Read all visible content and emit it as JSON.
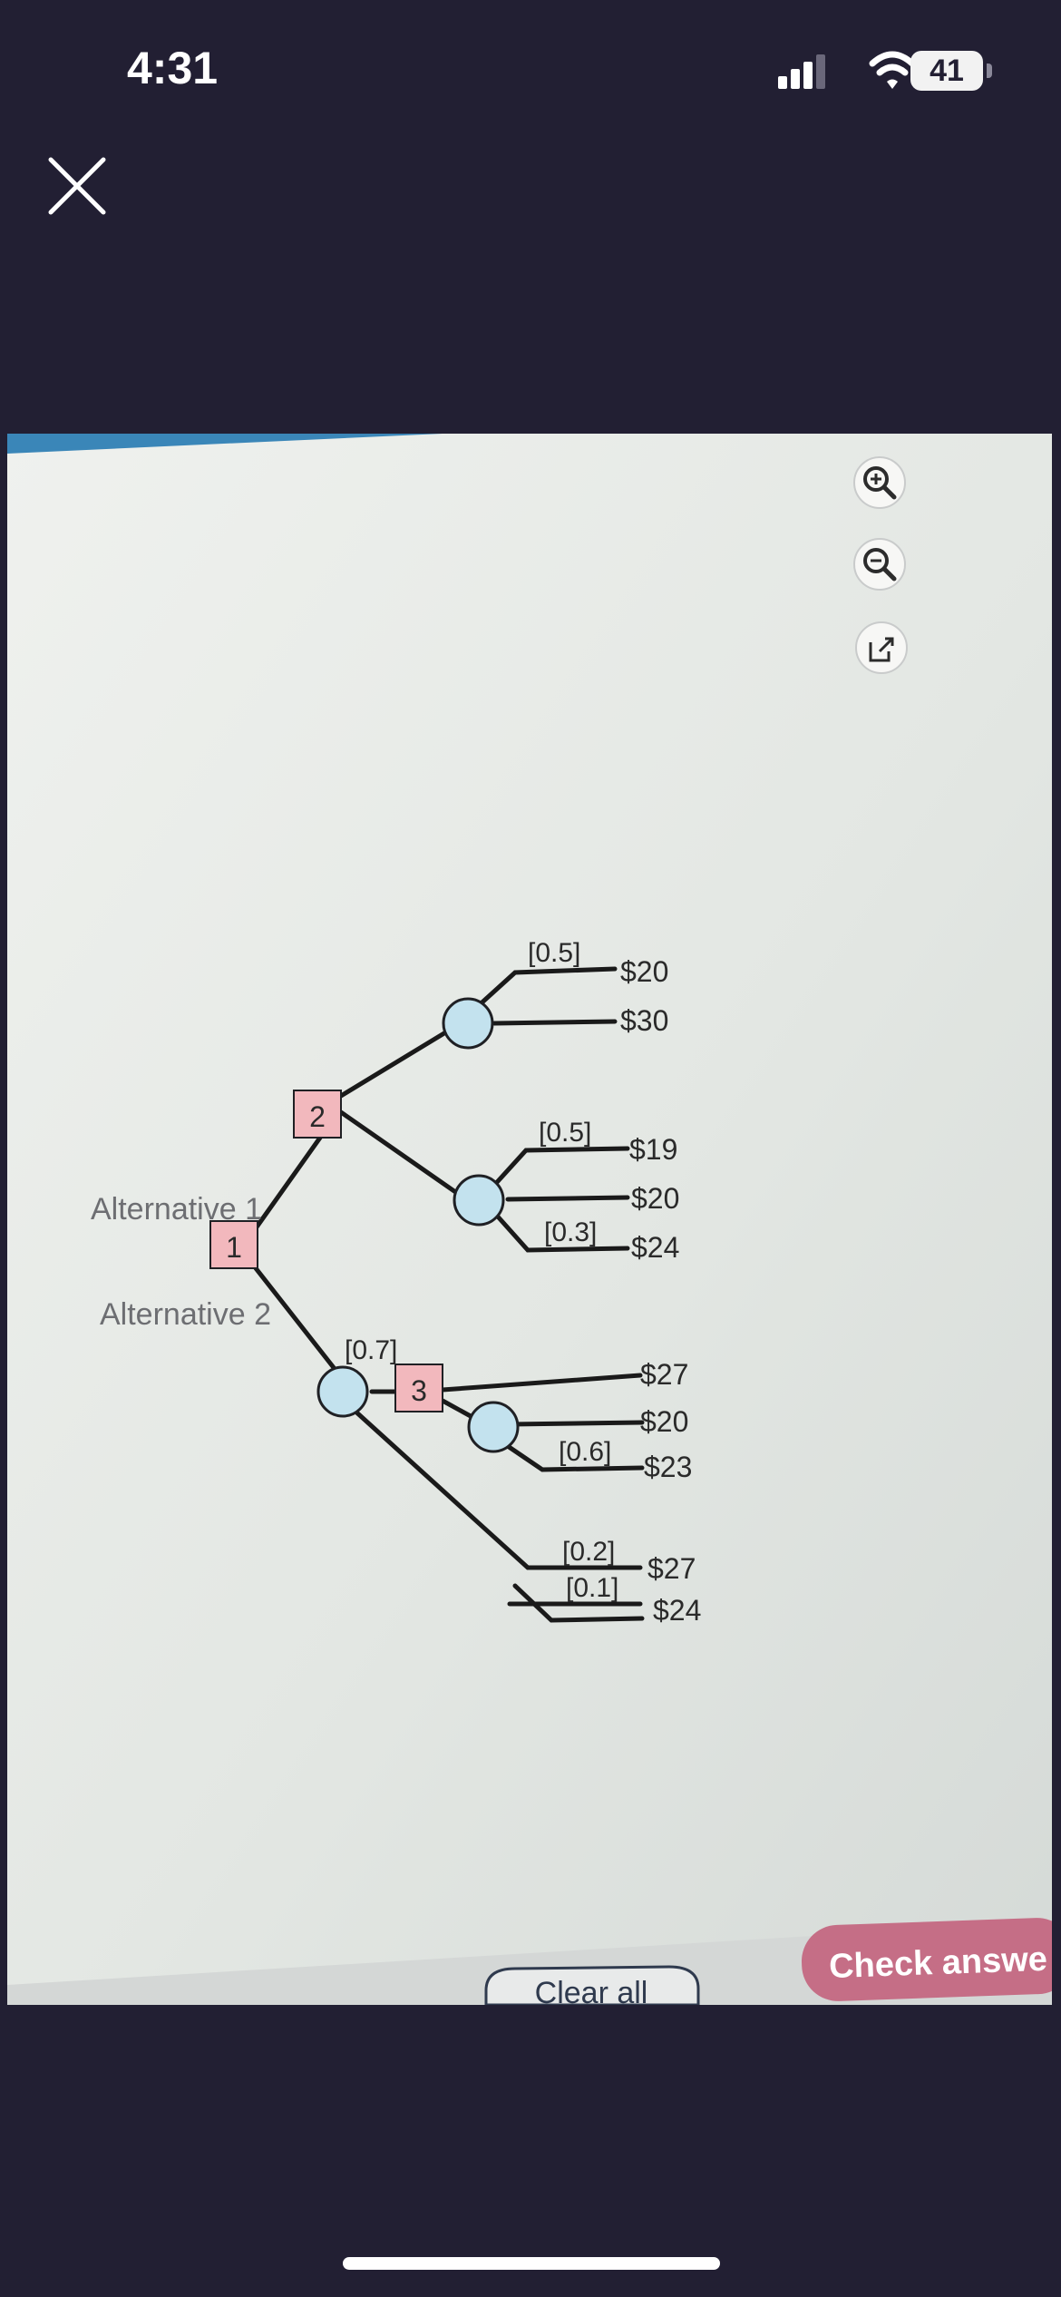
{
  "status_bar": {
    "time": "4:31",
    "battery_level": "41"
  },
  "colors": {
    "background": "#221f33",
    "decision_node": "#f2b8bd",
    "chance_node": "#c3e2ee",
    "check_button": "#c56e86"
  },
  "icons": [
    "close-icon",
    "cellular-signal-icon",
    "wifi-icon",
    "battery-icon",
    "zoom-in-icon",
    "zoom-out-icon",
    "open-external-icon"
  ],
  "tree": {
    "alternative_1": "Alternative 1",
    "alternative_2": "Alternative 2",
    "decision_nodes": [
      "1",
      "2",
      "3"
    ],
    "probabilities": [
      "[0.5]",
      "[0.5]",
      "[0.3]",
      "[0.7]",
      "[0.6]",
      "[0.2]",
      "[0.1]"
    ],
    "payoffs": [
      "$20",
      "$30",
      "$19",
      "$20",
      "$24",
      "$27",
      "$20",
      "$23",
      "$27",
      "$24"
    ]
  },
  "buttons": {
    "clear_all": "Clear all",
    "check_answer": "Check answe"
  }
}
